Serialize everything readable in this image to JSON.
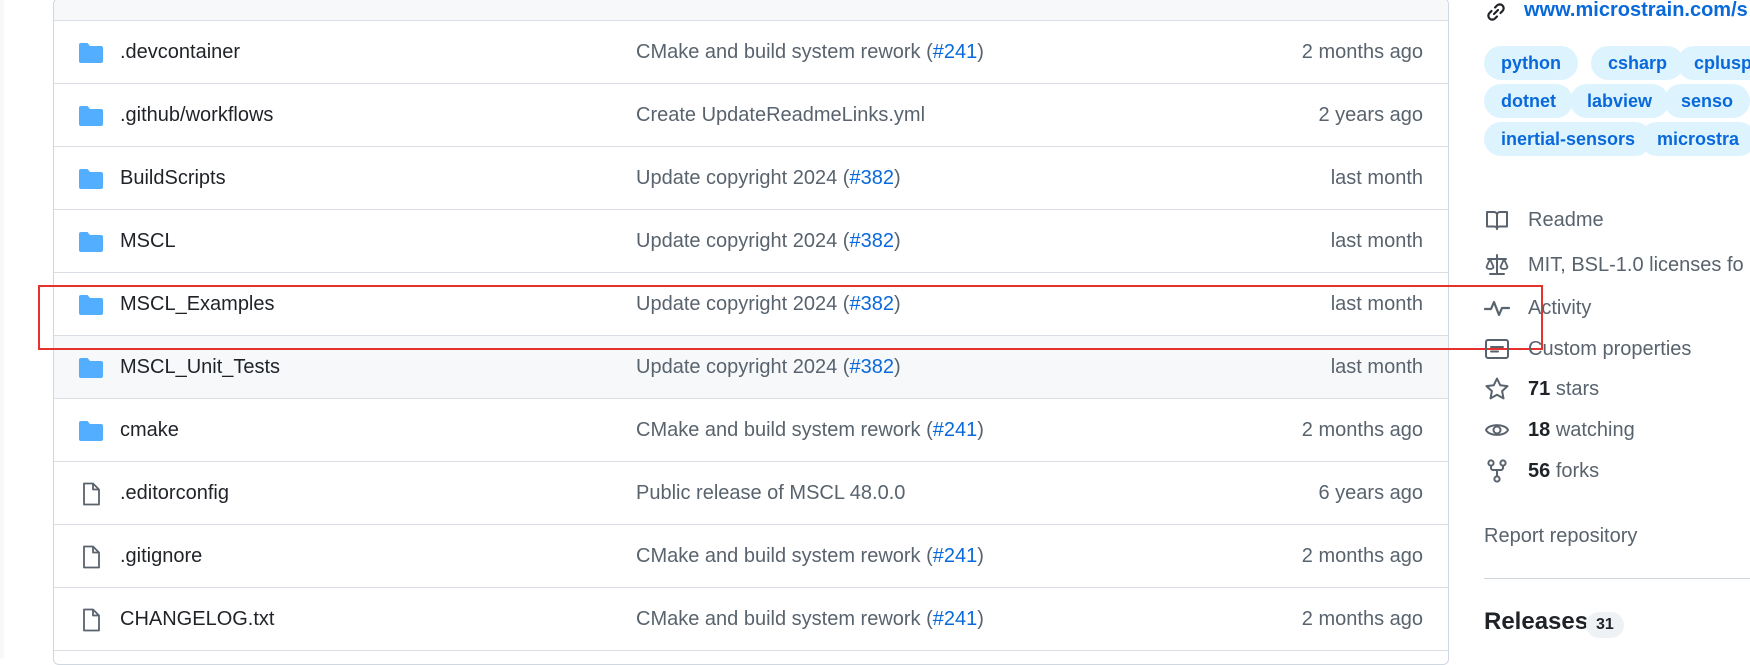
{
  "files": [
    {
      "name": ".devcontainer",
      "type": "folder",
      "message": "CMake and build system rework (",
      "pr": "#241",
      "message_end": ")",
      "date": "2 months ago"
    },
    {
      "name": ".github/workflows",
      "type": "folder",
      "message": "Create UpdateReadmeLinks.yml",
      "pr": "",
      "message_end": "",
      "date": "2 years ago"
    },
    {
      "name": "BuildScripts",
      "type": "folder",
      "message": "Update copyright 2024 (",
      "pr": "#382",
      "message_end": ")",
      "date": "last month"
    },
    {
      "name": "MSCL",
      "type": "folder",
      "message": "Update copyright 2024 (",
      "pr": "#382",
      "message_end": ")",
      "date": "last month"
    },
    {
      "name": "MSCL_Examples",
      "type": "folder",
      "message": "Update copyright 2024 (",
      "pr": "#382",
      "message_end": ")",
      "date": "last month"
    },
    {
      "name": "MSCL_Unit_Tests",
      "type": "folder",
      "message": "Update copyright 2024 (",
      "pr": "#382",
      "message_end": ")",
      "date": "last month"
    },
    {
      "name": "cmake",
      "type": "folder",
      "message": "CMake and build system rework (",
      "pr": "#241",
      "message_end": ")",
      "date": "2 months ago"
    },
    {
      "name": ".editorconfig",
      "type": "file",
      "message": "Public release of MSCL 48.0.0",
      "pr": "",
      "message_end": "",
      "date": "6 years ago"
    },
    {
      "name": ".gitignore",
      "type": "file",
      "message": "CMake and build system rework (",
      "pr": "#241",
      "message_end": ")",
      "date": "2 months ago"
    },
    {
      "name": "CHANGELOG.txt",
      "type": "file",
      "message": "CMake and build system rework (",
      "pr": "#241",
      "message_end": ")",
      "date": "2 months ago"
    }
  ],
  "highlighted_row": "MSCL_Examples",
  "sidebar": {
    "website": "www.microstrain.com/s",
    "topics": [
      "python",
      "csharp",
      "cplusp",
      "dotnet",
      "labview",
      "senso",
      "inertial-sensors",
      "microstra"
    ],
    "readme": "Readme",
    "license": "MIT, BSL-1.0 licenses fo",
    "activity": "Activity",
    "custom_properties": "Custom properties",
    "stars_count": "71",
    "stars_label": "stars",
    "watching_count": "18",
    "watching_label": "watching",
    "forks_count": "56",
    "forks_label": "forks",
    "report": "Report repository",
    "releases_title": "Releases",
    "releases_count": "31"
  },
  "colors": {
    "folder_icon": "#54aeff",
    "link": "#0969da",
    "muted_text": "#59636e",
    "topic_bg": "#ddf4ff",
    "highlight_border": "#e5322d"
  }
}
